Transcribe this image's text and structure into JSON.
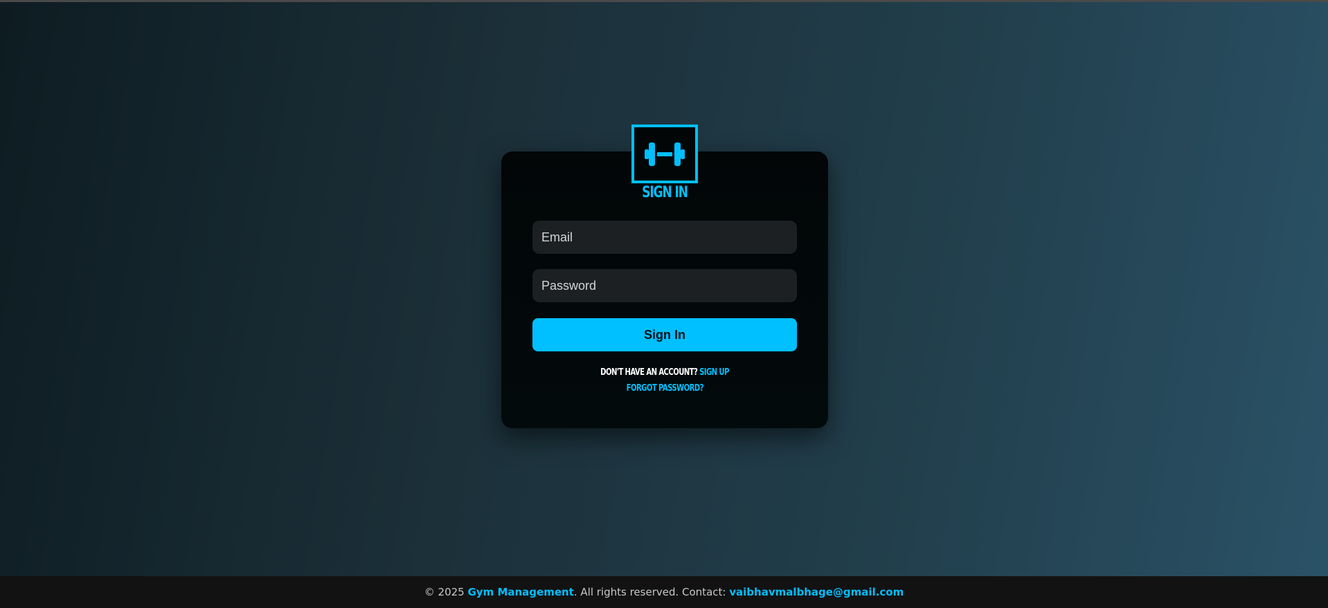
{
  "logo": {
    "icon": "dumbbell-icon",
    "color": "#00bfff"
  },
  "form": {
    "title": "Sign In",
    "email_placeholder": "Email",
    "password_placeholder": "Password",
    "submit_label": "Sign In",
    "signup_prompt": "Don't have an account?",
    "signup_link": "Sign Up",
    "forgot_link": "Forgot Password?"
  },
  "footer": {
    "copyright": "© 2025",
    "brand": "Gym Management",
    "rights": ". All rights reserved. Contact:",
    "email": "vaibhavmalbhage@gmail.com"
  },
  "colors": {
    "accent": "#00bfff",
    "card": "#020607",
    "field": "#1c2023",
    "footer": "#121212"
  }
}
